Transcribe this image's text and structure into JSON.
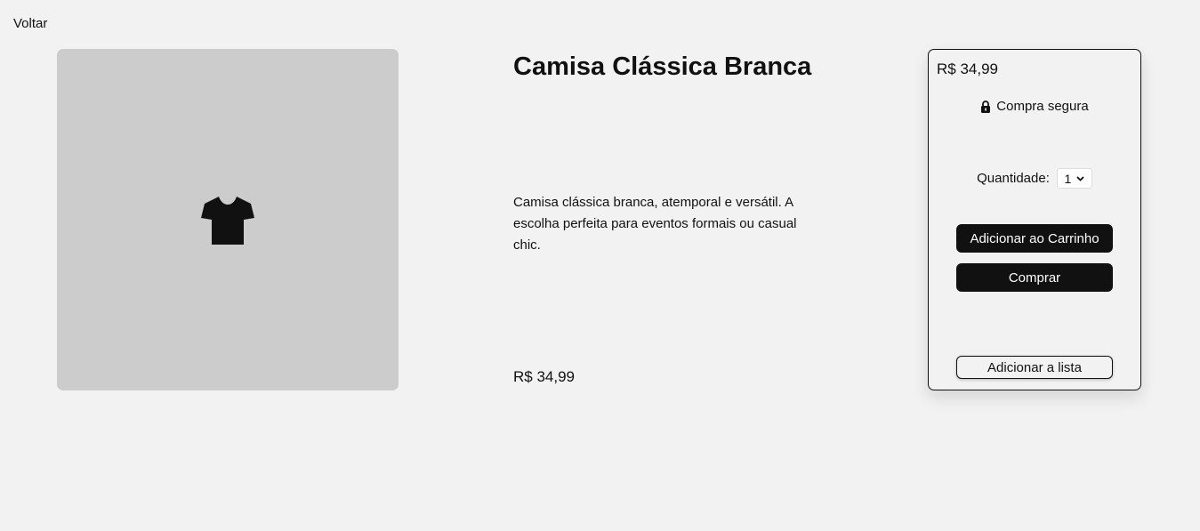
{
  "nav": {
    "back_label": "Voltar"
  },
  "product": {
    "title": "Camisa Clássica Branca",
    "description": "Camisa clássica branca, atemporal e versátil. A escolha perfeita para eventos formais ou casual chic.",
    "price": "R$ 34,99",
    "image_icon": "tshirt-icon"
  },
  "buy_box": {
    "price": "R$ 34,99",
    "secure_label": "Compra segura",
    "quantity_label": "Quantidade:",
    "quantity_value": "1",
    "add_to_cart_label": "Adicionar ao Carrinho",
    "buy_label": "Comprar",
    "add_to_list_label": "Adicionar a lista"
  },
  "colors": {
    "background": "#f2f2f2",
    "image_placeholder": "#cccccc",
    "primary_button": "#111111"
  }
}
